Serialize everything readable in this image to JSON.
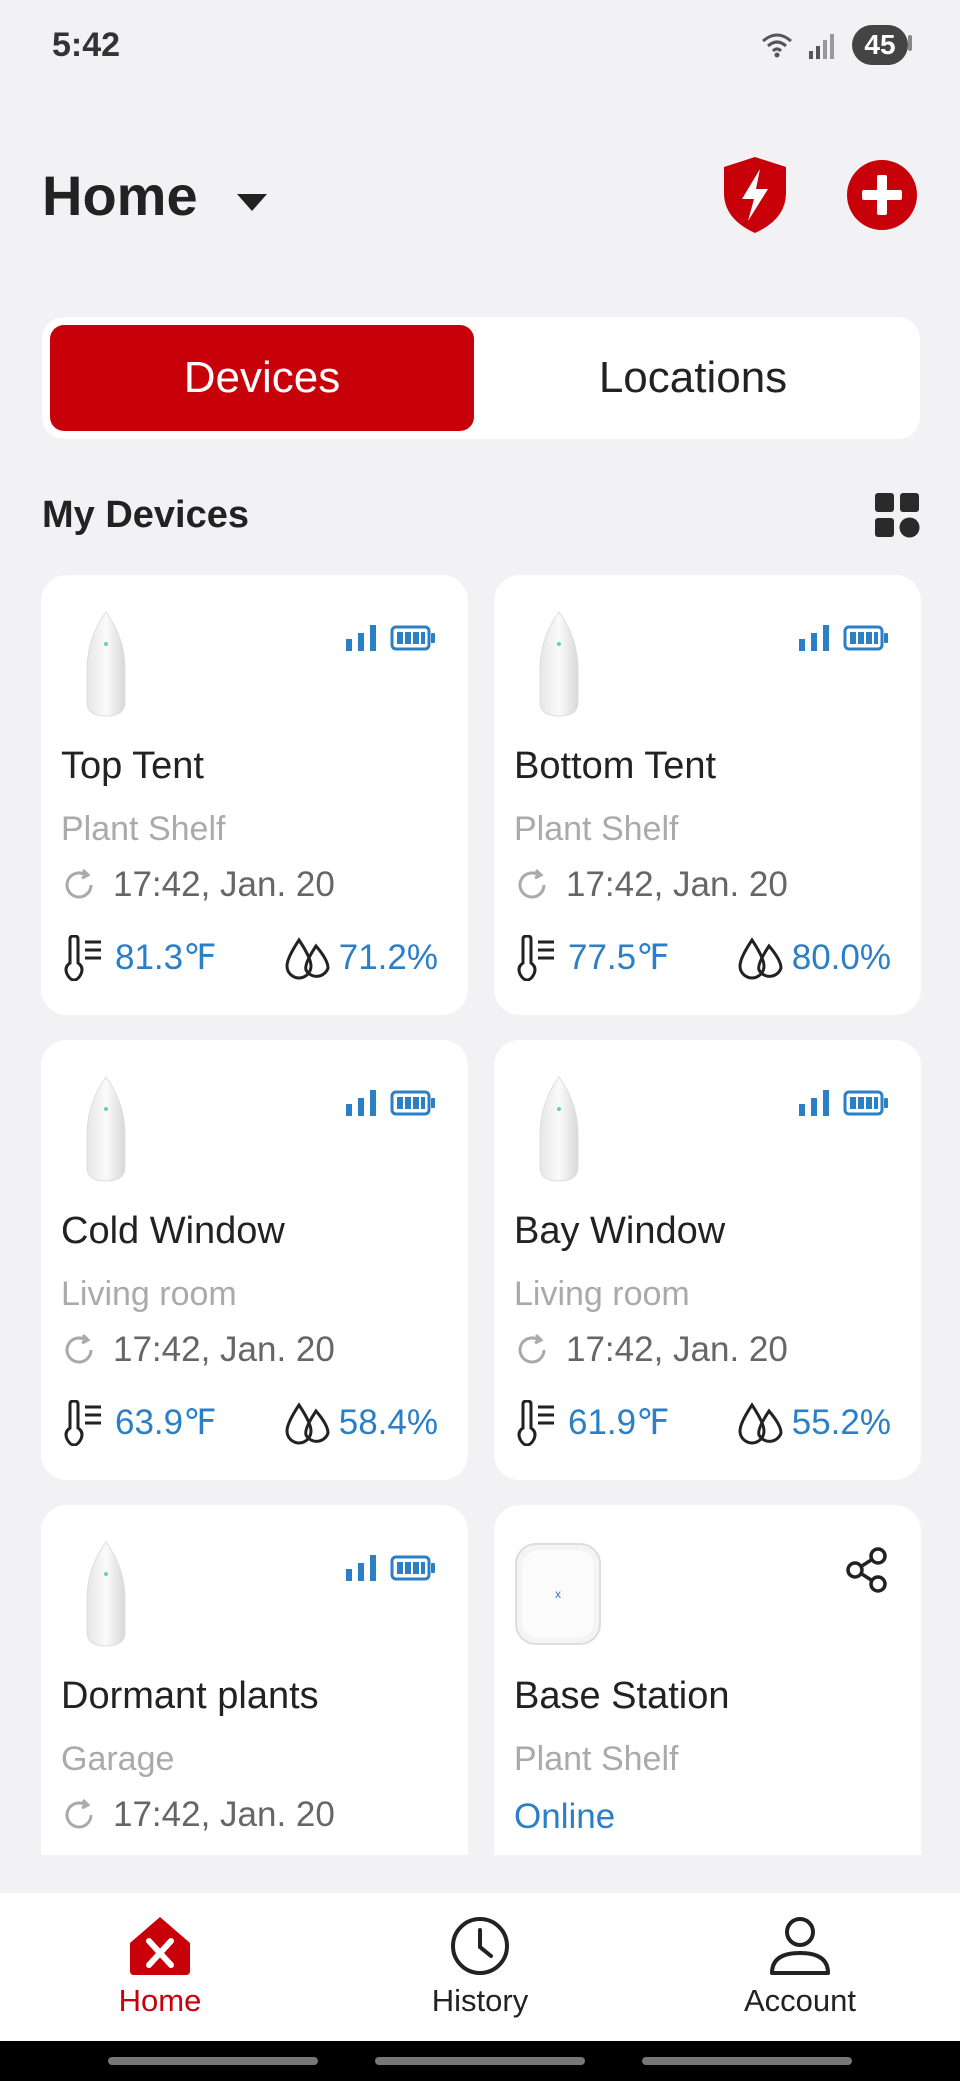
{
  "status": {
    "time": "5:42",
    "battery": "45"
  },
  "header": {
    "title": "Home"
  },
  "tabs": [
    {
      "label": "Devices",
      "active": true
    },
    {
      "label": "Locations",
      "active": false
    }
  ],
  "section": {
    "title": "My Devices"
  },
  "devices": [
    {
      "name": "Top Tent",
      "location": "Plant Shelf",
      "updated": "17:42, Jan. 20",
      "temp": "81.3℉",
      "humidity": "71.2%"
    },
    {
      "name": "Bottom Tent",
      "location": "Plant Shelf",
      "updated": "17:42, Jan. 20",
      "temp": "77.5℉",
      "humidity": "80.0%"
    },
    {
      "name": "Cold Window",
      "location": "Living room",
      "updated": "17:42, Jan. 20",
      "temp": "63.9℉",
      "humidity": "58.4%"
    },
    {
      "name": "Bay Window",
      "location": "Living room",
      "updated": "17:42, Jan. 20",
      "temp": "61.9℉",
      "humidity": "55.2%"
    },
    {
      "name": "Dormant plants",
      "location": "Garage",
      "updated": "17:42, Jan. 20"
    },
    {
      "name": "Base Station",
      "location": "Plant Shelf",
      "status": "Online"
    }
  ],
  "nav": [
    {
      "label": "Home",
      "icon": "home-logo-icon",
      "active": true
    },
    {
      "label": "History",
      "icon": "clock-icon",
      "active": false
    },
    {
      "label": "Account",
      "icon": "person-icon",
      "active": false
    }
  ],
  "colors": {
    "accent": "#c8000a",
    "value_blue": "#2a7fc7",
    "background": "#f2f2f4"
  }
}
